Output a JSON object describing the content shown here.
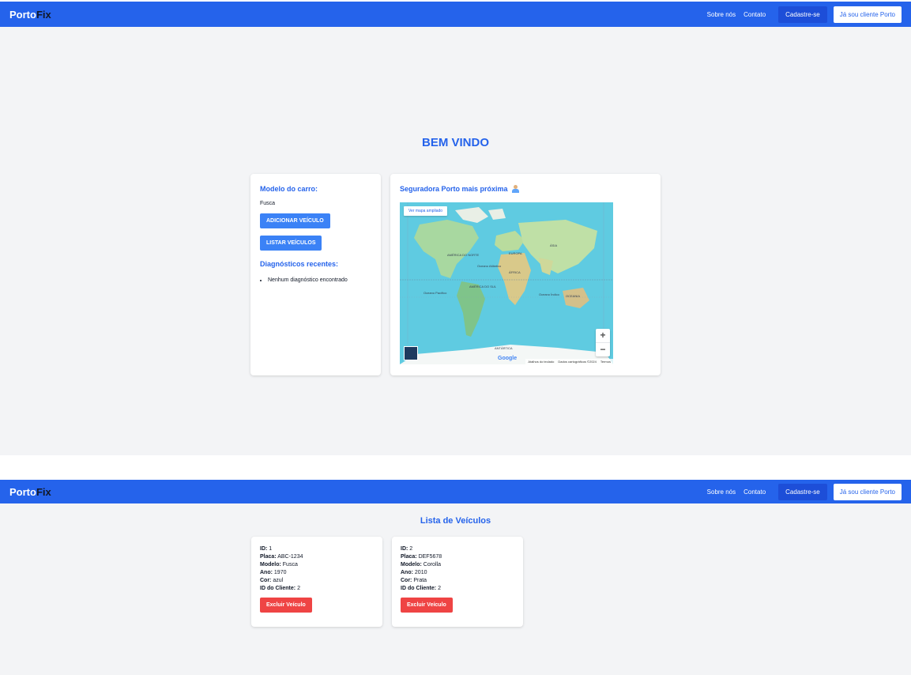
{
  "brand": {
    "part1": "Porto",
    "part2": "Fix"
  },
  "nav": {
    "about": "Sobre nós",
    "contact": "Contato",
    "signup": "Cadastre-se",
    "client": "Já sou cliente Porto"
  },
  "home": {
    "welcome": "BEM VINDO",
    "car_card": {
      "title": "Modelo do carro:",
      "model": "Fusca",
      "add_button": "ADICIONAR VEÍCULO",
      "list_button": "LISTAR VEÍCULOS",
      "diag_title": "Diagnósticos recentes:",
      "diag_items": [
        "Nenhum diagnóstico encontrado"
      ]
    },
    "map_card": {
      "title": "Seguradora Porto mais próxima",
      "map_button": "Ver mapa ampliado",
      "zoom_in": "+",
      "zoom_out": "−",
      "google": "Google",
      "attribution": [
        "Atalhos do teclado",
        "Dados cartográficos ©2024",
        "Termos"
      ],
      "labels": [
        "AMÉRICA DO NORTE",
        "EUROPA",
        "ÁSIA",
        "ÁFRICA",
        "AMÉRICA DO SUL",
        "OCEANIA",
        "ANTÁRTICA",
        "Oceano Atlântico",
        "Oceano Pacífico",
        "Oceano Índico"
      ]
    }
  },
  "vehicles": {
    "title": "Lista de Veículos",
    "labels": {
      "id": "ID:",
      "plate": "Placa:",
      "model": "Modelo:",
      "year": "Ano:",
      "color": "Cor:",
      "client": "ID do Cliente:"
    },
    "delete_button": "Excluir Veículo",
    "items": [
      {
        "id": "1",
        "plate": "ABC-1234",
        "model": "Fusca",
        "year": "1970",
        "color": "azul",
        "client": "2"
      },
      {
        "id": "2",
        "plate": "DEF5678",
        "model": "Corolla",
        "year": "2010",
        "color": "Prata",
        "client": "2"
      }
    ]
  },
  "colors": {
    "primary": "#2563eb",
    "button": "#3b82f6",
    "danger": "#ef4444",
    "background": "#f3f4f6"
  },
  "icons": {
    "map_title": "person-icon"
  }
}
